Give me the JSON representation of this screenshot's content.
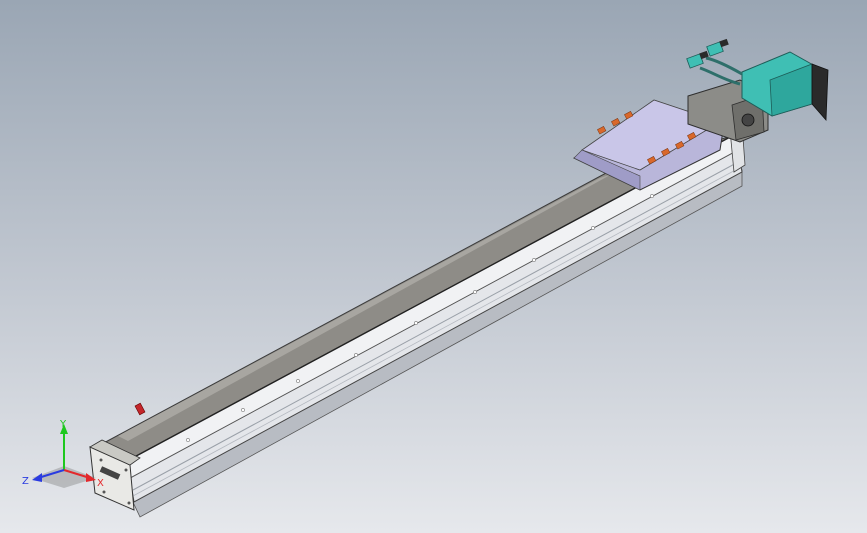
{
  "viewport": {
    "background_top": "#9aa6b4",
    "background_bottom": "#e6e8ec"
  },
  "model": {
    "rail_color": "#d7dadf",
    "cover_color": "#8e8c87",
    "carriage_color": "#b9b6da",
    "motor_color": "#3fbfb4",
    "accent_color": "#d9682b"
  },
  "triad": {
    "x_label": "X",
    "y_label": "Y",
    "z_label": "Z",
    "x_color": "#e3282c",
    "y_color": "#1ec81e",
    "z_color": "#2a3be0"
  }
}
